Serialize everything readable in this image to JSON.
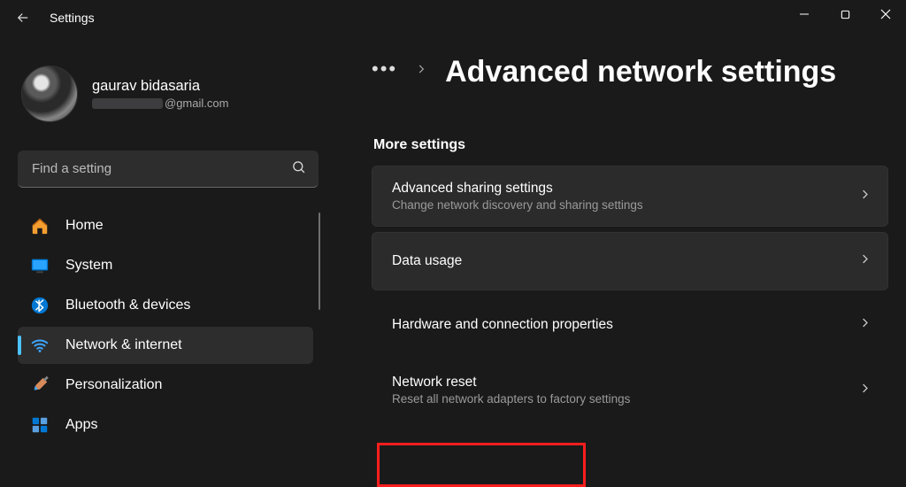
{
  "titlebar": {
    "title": "Settings"
  },
  "profile": {
    "name": "gaurav bidasaria",
    "email_suffix": "@gmail.com"
  },
  "search": {
    "placeholder": "Find a setting"
  },
  "sidebar": {
    "items": [
      {
        "key": "home",
        "label": "Home",
        "icon": "home"
      },
      {
        "key": "system",
        "label": "System",
        "icon": "system"
      },
      {
        "key": "bluetooth",
        "label": "Bluetooth & devices",
        "icon": "bluetooth"
      },
      {
        "key": "network",
        "label": "Network & internet",
        "icon": "wifi",
        "selected": true
      },
      {
        "key": "personalization",
        "label": "Personalization",
        "icon": "brush"
      },
      {
        "key": "apps",
        "label": "Apps",
        "icon": "apps"
      }
    ]
  },
  "breadcrumb": {
    "page_title": "Advanced network settings"
  },
  "section": {
    "label": "More settings",
    "cards": [
      {
        "title": "Advanced sharing settings",
        "sub": "Change network discovery and sharing settings",
        "boxed": true
      },
      {
        "title": "Data usage",
        "sub": "",
        "boxed": true
      },
      {
        "title": "Hardware and connection properties",
        "sub": "",
        "boxed": false
      },
      {
        "title": "Network reset",
        "sub": "Reset all network adapters to factory settings",
        "boxed": false
      }
    ]
  }
}
